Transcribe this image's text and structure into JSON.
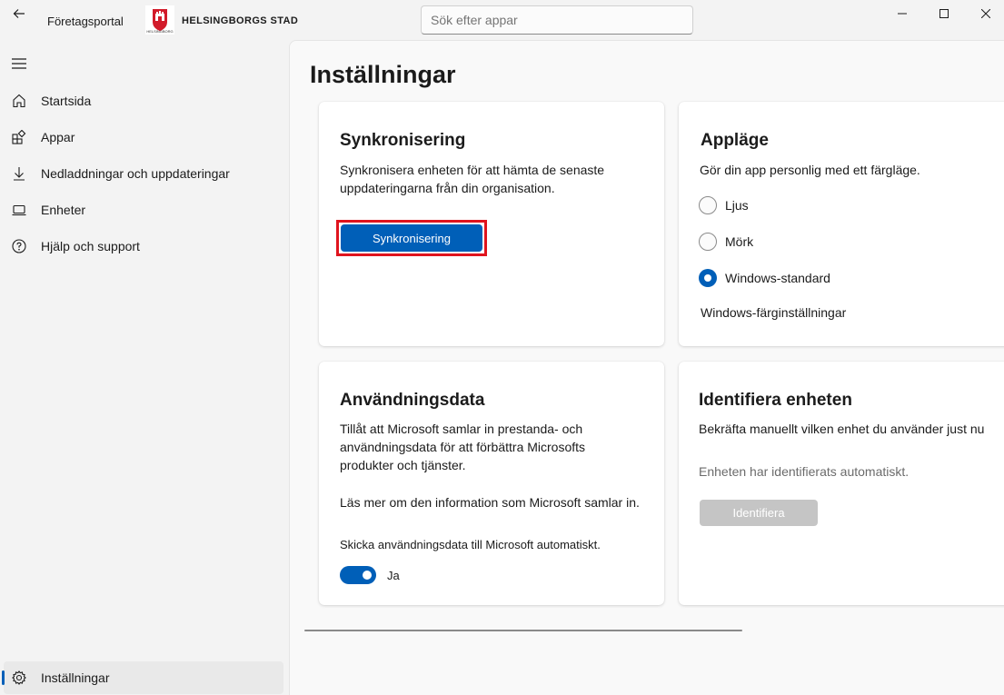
{
  "titlebar": {
    "app_title": "Företagsportal",
    "org_name": "HELSINGBORGS STAD",
    "logo_caption": "HELSINGBORG",
    "search_placeholder": "Sök efter appar"
  },
  "sidebar": {
    "items": [
      {
        "label": "Startsida",
        "icon": "home-icon"
      },
      {
        "label": "Appar",
        "icon": "apps-icon"
      },
      {
        "label": "Nedladdningar och uppdateringar",
        "icon": "download-icon"
      },
      {
        "label": "Enheter",
        "icon": "laptop-icon"
      },
      {
        "label": "Hjälp och support",
        "icon": "help-icon"
      }
    ],
    "settings_label": "Inställningar"
  },
  "main": {
    "title": "Inställningar",
    "sync_card": {
      "title": "Synkronisering",
      "description": "Synkronisera enheten för att hämta de senaste uppdateringarna från din organisation.",
      "button_label": "Synkronisering"
    },
    "app_mode_card": {
      "title": "Appläge",
      "description": "Gör din app personlig med ett färgläge.",
      "options": [
        "Ljus",
        "Mörk",
        "Windows-standard"
      ],
      "selected": "Windows-standard",
      "link": "Windows-färginställningar"
    },
    "usage_card": {
      "title": "Användningsdata",
      "description": "Tillåt att Microsoft samlar in prestanda- och användningsdata för att förbättra Microsofts produkter och tjänster.",
      "link": "Läs mer om den information som Microsoft samlar in.",
      "toggle_caption": "Skicka användningsdata till Microsoft automatiskt.",
      "toggle_state": "Ja"
    },
    "identify_card": {
      "title": "Identifiera enheten",
      "description": "Bekräfta manuellt vilken enhet du använder just nu",
      "status": "Enheten har identifierats automatiskt.",
      "button_label": "Identifiera"
    }
  },
  "colors": {
    "accent": "#005fb8",
    "link": "#003e92",
    "highlight": "#e0141e",
    "disabled": "#c5c5c5"
  }
}
